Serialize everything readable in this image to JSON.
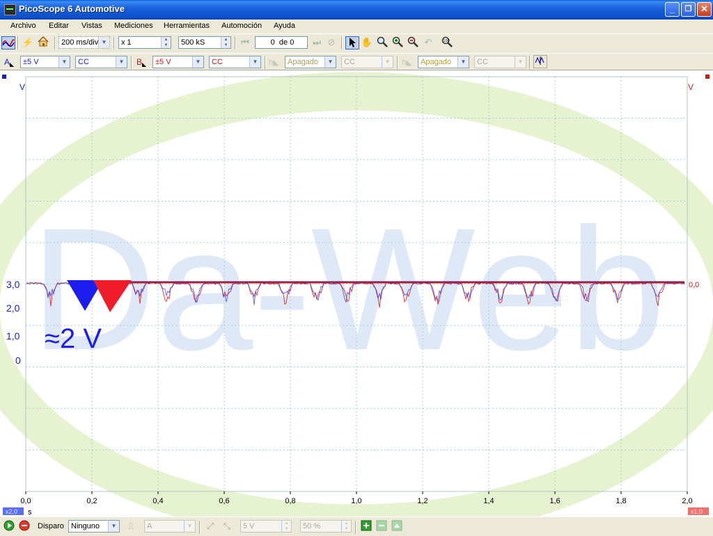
{
  "window": {
    "title": "PicoScope 6 Automotive",
    "buttons": {
      "minimize": "_",
      "maximize": "❐",
      "close": "✕"
    }
  },
  "menu": [
    "Archivo",
    "Editar",
    "Vistas",
    "Mediciones",
    "Herramientas",
    "Automoción",
    "Ayuda"
  ],
  "toolbar": {
    "timebase": "200 ms/div",
    "zoom": "x 1",
    "samples": "500 kS",
    "buffer_index": "0",
    "buffer_of": "de 0"
  },
  "channels": [
    {
      "letter": "A",
      "range": "±5 V",
      "coupling": "CC",
      "color": "#1b1bd6",
      "enabled": true
    },
    {
      "letter": "B",
      "range": "±5 V",
      "coupling": "CC",
      "color": "#cc1a1a",
      "enabled": true
    },
    {
      "letter": "C",
      "range": "Apagado",
      "coupling": "CC",
      "color": "#b8a84a",
      "enabled": false
    },
    {
      "letter": "D",
      "range": "Apagado",
      "coupling": "CC",
      "color": "#b8a84a",
      "enabled": false
    }
  ],
  "scope": {
    "left_unit": "V",
    "right_unit": "V",
    "left_ticks": [
      "3,0",
      "2,0",
      "1,0",
      "0"
    ],
    "right_ticks": [
      "0,0"
    ],
    "x_ticks": [
      "0,0",
      "0,2",
      "0,4",
      "0,6",
      "0,8",
      "1,0",
      "1,2",
      "1,4",
      "1,6",
      "1,8",
      "2,0"
    ],
    "x_unit": "s",
    "annotation": "≈2 V",
    "watermark": "Da-Web",
    "zoom_left": "x2,0",
    "zoom_right": "x1,0"
  },
  "chart_data": {
    "type": "line",
    "x_range": [
      0,
      2.0
    ],
    "x_unit": "s",
    "series": [
      {
        "channel": "A",
        "baseline": 3.0,
        "min": 2.0
      },
      {
        "channel": "B",
        "baseline": 3.0,
        "min": 2.0
      }
    ]
  },
  "statusbar": {
    "trigger_label": "Disparo",
    "trigger_mode": "Ninguno",
    "trigger_channel": "A",
    "threshold": "5 V",
    "pretrigger": "50 %"
  }
}
